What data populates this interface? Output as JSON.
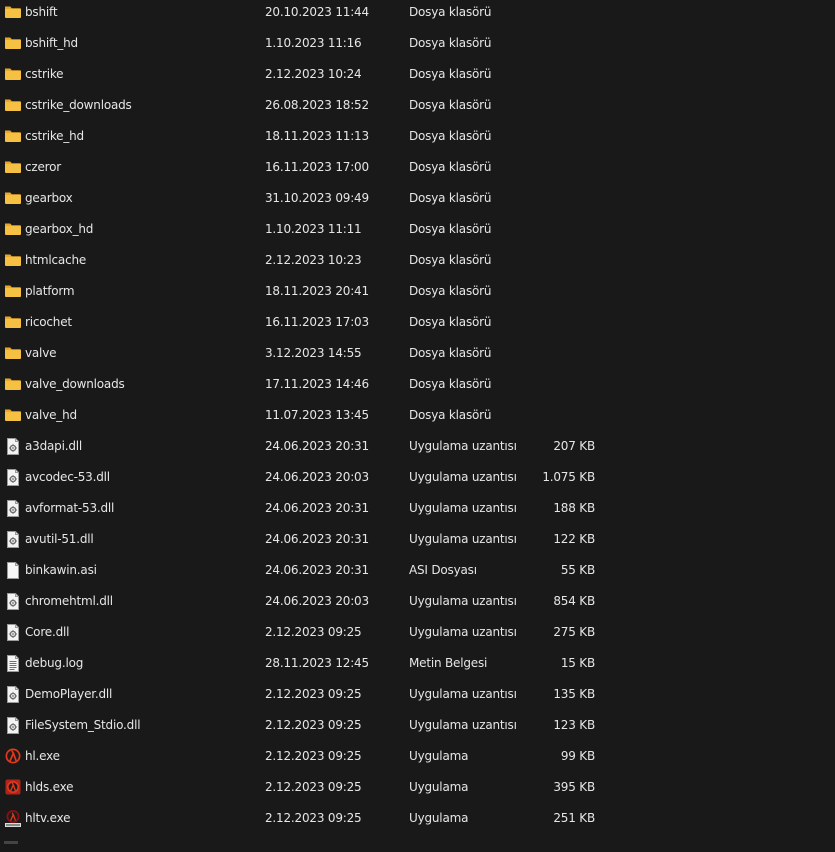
{
  "files": [
    {
      "name": "bshift",
      "date": "20.10.2023 11:44",
      "type": "Dosya klasörü",
      "size": "",
      "icon": "folder-icon"
    },
    {
      "name": "bshift_hd",
      "date": "1.10.2023 11:16",
      "type": "Dosya klasörü",
      "size": "",
      "icon": "folder-icon"
    },
    {
      "name": "cstrike",
      "date": "2.12.2023 10:24",
      "type": "Dosya klasörü",
      "size": "",
      "icon": "folder-icon"
    },
    {
      "name": "cstrike_downloads",
      "date": "26.08.2023 18:52",
      "type": "Dosya klasörü",
      "size": "",
      "icon": "folder-icon"
    },
    {
      "name": "cstrike_hd",
      "date": "18.11.2023 11:13",
      "type": "Dosya klasörü",
      "size": "",
      "icon": "folder-icon"
    },
    {
      "name": "czeror",
      "date": "16.11.2023 17:00",
      "type": "Dosya klasörü",
      "size": "",
      "icon": "folder-icon"
    },
    {
      "name": "gearbox",
      "date": "31.10.2023 09:49",
      "type": "Dosya klasörü",
      "size": "",
      "icon": "folder-icon"
    },
    {
      "name": "gearbox_hd",
      "date": "1.10.2023 11:11",
      "type": "Dosya klasörü",
      "size": "",
      "icon": "folder-icon"
    },
    {
      "name": "htmlcache",
      "date": "2.12.2023 10:23",
      "type": "Dosya klasörü",
      "size": "",
      "icon": "folder-icon"
    },
    {
      "name": "platform",
      "date": "18.11.2023 20:41",
      "type": "Dosya klasörü",
      "size": "",
      "icon": "folder-icon"
    },
    {
      "name": "ricochet",
      "date": "16.11.2023 17:03",
      "type": "Dosya klasörü",
      "size": "",
      "icon": "folder-icon"
    },
    {
      "name": "valve",
      "date": "3.12.2023 14:55",
      "type": "Dosya klasörü",
      "size": "",
      "icon": "folder-icon"
    },
    {
      "name": "valve_downloads",
      "date": "17.11.2023 14:46",
      "type": "Dosya klasörü",
      "size": "",
      "icon": "folder-icon"
    },
    {
      "name": "valve_hd",
      "date": "11.07.2023 13:45",
      "type": "Dosya klasörü",
      "size": "",
      "icon": "folder-icon"
    },
    {
      "name": "a3dapi.dll",
      "date": "24.06.2023 20:31",
      "type": "Uygulama uzantısı",
      "size": "207 KB",
      "icon": "dll-file-icon"
    },
    {
      "name": "avcodec-53.dll",
      "date": "24.06.2023 20:03",
      "type": "Uygulama uzantısı",
      "size": "1.075 KB",
      "icon": "dll-file-icon"
    },
    {
      "name": "avformat-53.dll",
      "date": "24.06.2023 20:31",
      "type": "Uygulama uzantısı",
      "size": "188 KB",
      "icon": "dll-file-icon"
    },
    {
      "name": "avutil-51.dll",
      "date": "24.06.2023 20:31",
      "type": "Uygulama uzantısı",
      "size": "122 KB",
      "icon": "dll-file-icon"
    },
    {
      "name": "binkawin.asi",
      "date": "24.06.2023 20:31",
      "type": "ASI Dosyası",
      "size": "55 KB",
      "icon": "blank-file-icon"
    },
    {
      "name": "chromehtml.dll",
      "date": "24.06.2023 20:03",
      "type": "Uygulama uzantısı",
      "size": "854 KB",
      "icon": "dll-file-icon"
    },
    {
      "name": "Core.dll",
      "date": "2.12.2023 09:25",
      "type": "Uygulama uzantısı",
      "size": "275 KB",
      "icon": "dll-file-icon"
    },
    {
      "name": "debug.log",
      "date": "28.11.2023 12:45",
      "type": "Metin Belgesi",
      "size": "15 KB",
      "icon": "text-file-icon"
    },
    {
      "name": "DemoPlayer.dll",
      "date": "2.12.2023 09:25",
      "type": "Uygulama uzantısı",
      "size": "135 KB",
      "icon": "dll-file-icon"
    },
    {
      "name": "FileSystem_Stdio.dll",
      "date": "2.12.2023 09:25",
      "type": "Uygulama uzantısı",
      "size": "123 KB",
      "icon": "dll-file-icon"
    },
    {
      "name": "hl.exe",
      "date": "2.12.2023 09:25",
      "type": "Uygulama",
      "size": "99 KB",
      "icon": "half-life-icon"
    },
    {
      "name": "hlds.exe",
      "date": "2.12.2023 09:25",
      "type": "Uygulama",
      "size": "395 KB",
      "icon": "hlds-icon"
    },
    {
      "name": "hltv.exe",
      "date": "2.12.2023 09:25",
      "type": "Uygulama",
      "size": "251 KB",
      "icon": "hltv-icon"
    }
  ],
  "colors": {
    "background": "#191919",
    "text": "#e6e6e6",
    "folder": "#f6c143",
    "half_life_accent": "#e2381c"
  }
}
